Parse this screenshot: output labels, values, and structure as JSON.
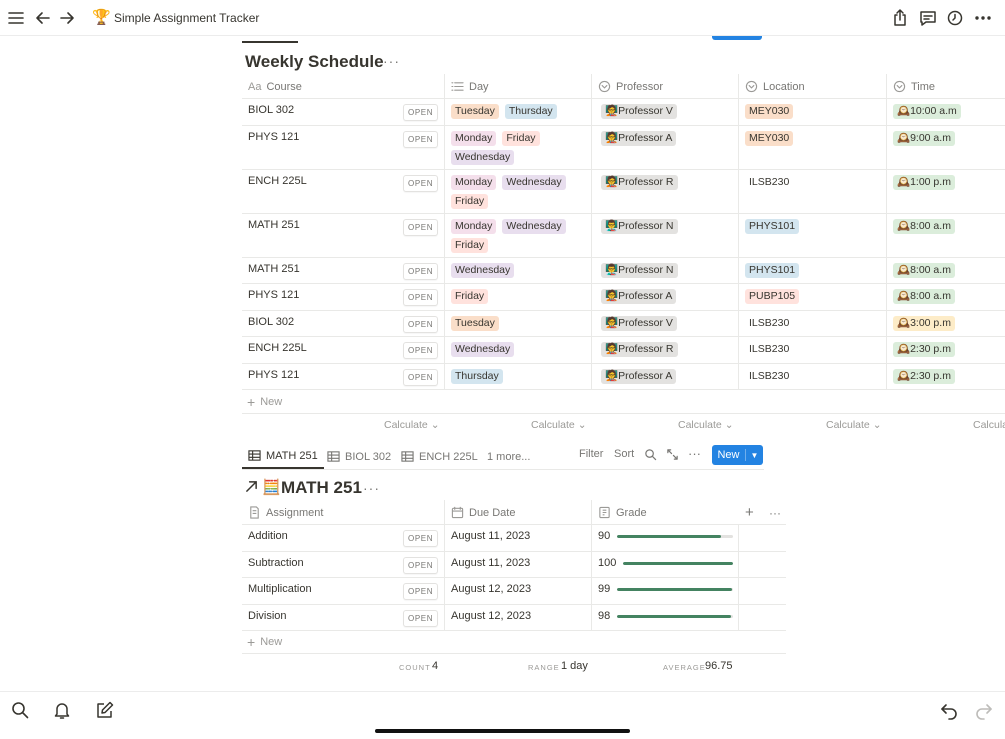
{
  "app": {
    "title": "Simple Assignment Tracker",
    "title_emoji": "🏆"
  },
  "weekly_schedule": {
    "title": "Weekly Schedule",
    "columns": [
      {
        "label": "Course",
        "icon": "title-icon"
      },
      {
        "label": "Day",
        "icon": "list-icon"
      },
      {
        "label": "Professor",
        "icon": "select-icon"
      },
      {
        "label": "Location",
        "icon": "select-icon"
      },
      {
        "label": "Time",
        "icon": "select-icon"
      }
    ],
    "open_label": "OPEN",
    "rows": [
      {
        "course": "BIOL 302",
        "days": [
          "Tuesday",
          "Thursday"
        ],
        "professor": "Professor V",
        "location": "MEY030",
        "time": "10:00 a.m"
      },
      {
        "course": "PHYS 121",
        "days": [
          "Monday",
          "Friday",
          "Wednesday"
        ],
        "professor": "Professor A",
        "location": "MEY030",
        "time": "9:00 a.m"
      },
      {
        "course": "ENCH 225L",
        "days": [
          "Monday",
          "Wednesday",
          "Friday"
        ],
        "professor": "Professor R",
        "location": "ILSB230",
        "time": "1:00 p.m"
      },
      {
        "course": "MATH 251",
        "days": [
          "Monday",
          "Wednesday",
          "Friday"
        ],
        "professor": "Professor N",
        "location": "PHYS101",
        "time": "8:00 a.m"
      },
      {
        "course": "MATH 251",
        "days": [
          "Wednesday"
        ],
        "professor": "Professor N",
        "location": "PHYS101",
        "time": "8:00 a.m"
      },
      {
        "course": "PHYS 121",
        "days": [
          "Friday"
        ],
        "professor": "Professor A",
        "location": "PUBP105",
        "time": "8:00 a.m"
      },
      {
        "course": "BIOL 302",
        "days": [
          "Tuesday"
        ],
        "professor": "Professor V",
        "location": "ILSB230",
        "time": "3:00 p.m"
      },
      {
        "course": "ENCH 225L",
        "days": [
          "Wednesday"
        ],
        "professor": "Professor R",
        "location": "ILSB230",
        "time": "2:30 p.m"
      },
      {
        "course": "PHYS 121",
        "days": [
          "Thursday"
        ],
        "professor": "Professor A",
        "location": "ILSB230",
        "time": "2:30 p.m"
      }
    ],
    "new_label": "New",
    "calculate_label": "Calculate",
    "calculate_partial": "Calcula"
  },
  "view_tabs": {
    "tabs": [
      "MATH 251",
      "BIOL 302",
      "ENCH 225L"
    ],
    "more": "1 more...",
    "filter": "Filter",
    "sort": "Sort",
    "new_button": "New"
  },
  "math_table": {
    "title": "MATH 251",
    "title_emoji": "🧮",
    "columns": [
      {
        "label": "Assignment",
        "icon": "page-icon"
      },
      {
        "label": "Due Date",
        "icon": "calendar-icon"
      },
      {
        "label": "Grade",
        "icon": "number-icon"
      }
    ],
    "open_label": "OPEN",
    "rows": [
      {
        "assignment": "Addition",
        "due": "August 11, 2023",
        "grade": "90",
        "grade_fraction": 0.9
      },
      {
        "assignment": "Subtraction",
        "due": "August 11, 2023",
        "grade": "100",
        "grade_fraction": 1.0
      },
      {
        "assignment": "Multiplication",
        "due": "August 12, 2023",
        "grade": "99",
        "grade_fraction": 0.99
      },
      {
        "assignment": "Division",
        "due": "August 12, 2023",
        "grade": "98",
        "grade_fraction": 0.98
      }
    ],
    "new_label": "New",
    "footer": {
      "count_label": "COUNT",
      "count_value": "4",
      "range_label": "RANGE",
      "range_value": "1 day",
      "average_label": "AVERAGE",
      "average_value": "96.75"
    }
  },
  "colors": {
    "accent": "#2383e2",
    "progress": "#448361",
    "tag_day": {
      "Tuesday": "#fadec9",
      "Thursday": "#d3e5ef",
      "Monday": "#f4dfeb",
      "Friday": "#ffe2dd",
      "Wednesday": "#e8deee"
    }
  }
}
